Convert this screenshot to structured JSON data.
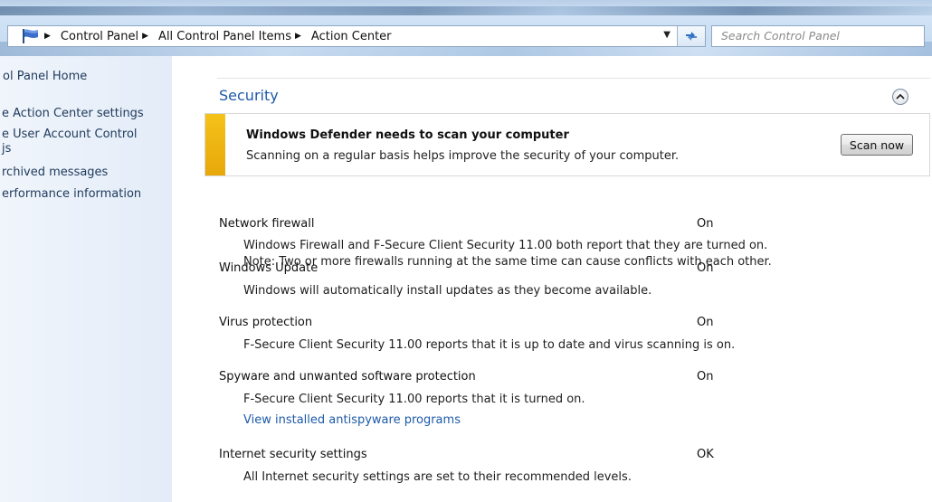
{
  "address_bar": {
    "breadcrumbs": [
      "Control Panel",
      "All Control Panel Items",
      "Action Center"
    ],
    "search_placeholder": "Search Control Panel"
  },
  "left_pane": {
    "home_link": "ol Panel Home",
    "links": [
      "e Action Center settings",
      "e User Account Control",
      "js",
      "rchived messages",
      "erformance information"
    ]
  },
  "security": {
    "title": "Security",
    "alert": {
      "title": "Windows Defender needs to scan your computer",
      "description": "Scanning on a regular basis helps improve the security of your computer.",
      "button": "Scan now"
    },
    "items": [
      {
        "name": "Network firewall",
        "status": "On",
        "desc1": "Windows Firewall and F-Secure Client Security 11.00 both report that they are turned on.",
        "desc2": "Note: Two or more firewalls running at the same time can cause conflicts with each other."
      },
      {
        "name": "Windows Update",
        "status": "On",
        "desc1": "Windows will automatically install updates as they become available."
      },
      {
        "name": "Virus protection",
        "status": "On",
        "desc1": "F-Secure Client Security 11.00 reports that it is up to date and virus scanning is on."
      },
      {
        "name": "Spyware and unwanted software protection",
        "status": "On",
        "desc1": "F-Secure Client Security 11.00 reports that it is turned on.",
        "link": "View installed antispyware programs"
      },
      {
        "name": "Internet security settings",
        "status": "OK",
        "desc1": "All Internet security settings are set to their recommended levels."
      }
    ]
  },
  "colors": {
    "accent": "#1e5aa8",
    "alert_stripe": "#f5c21a",
    "left_pane": "#e8eff9"
  },
  "icons": [
    "flag-icon",
    "breadcrumb-arrow-icon",
    "dropdown-arrow-icon",
    "refresh-icon",
    "chevron-up-icon"
  ]
}
